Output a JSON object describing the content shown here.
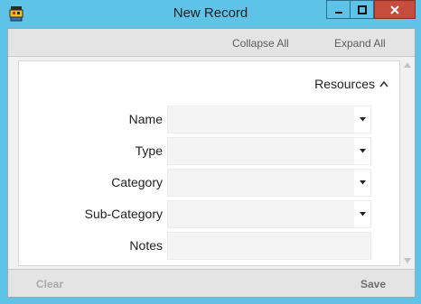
{
  "window": {
    "title": "New Record",
    "icon": "app-icon",
    "controls": [
      "minimize-icon",
      "maximize-icon",
      "close-icon"
    ],
    "titlebar_color": "#5fc3e8",
    "close_color": "#c64c3e"
  },
  "toolbar": {
    "collapse_all": "Collapse All",
    "expand_all": "Expand All"
  },
  "section": {
    "title": "Resources",
    "icon": "chevron-up-icon"
  },
  "fields": {
    "name": {
      "label": "Name",
      "value": "",
      "type": "dropdown"
    },
    "type": {
      "label": "Type",
      "value": "",
      "type": "dropdown"
    },
    "category": {
      "label": "Category",
      "value": "",
      "type": "dropdown"
    },
    "sub_category": {
      "label": "Sub-Category",
      "value": "",
      "type": "dropdown"
    },
    "notes": {
      "label": "Notes",
      "value": "",
      "type": "text"
    }
  },
  "footer": {
    "clear": "Clear",
    "save": "Save"
  }
}
